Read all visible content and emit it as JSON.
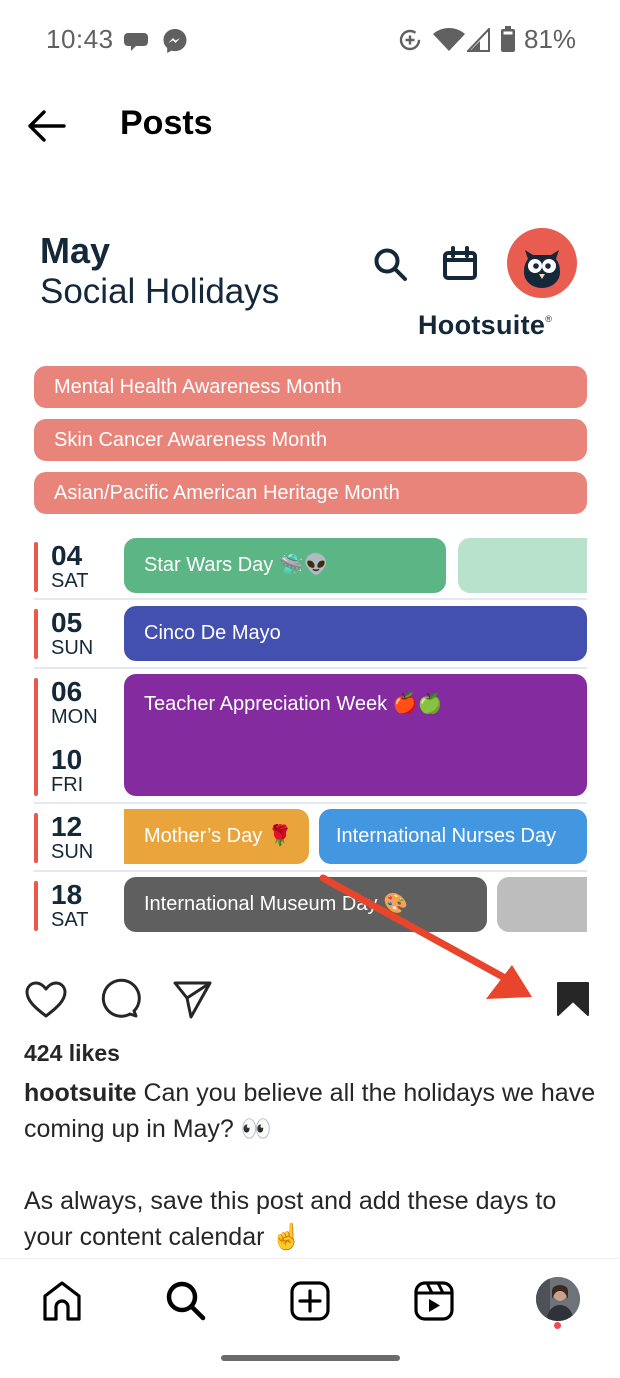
{
  "status_bar": {
    "time": "10:43",
    "notification_icons": [
      "messages-icon",
      "messenger-icon"
    ],
    "system_icons": [
      "data-saver-icon",
      "wifi-icon",
      "signal-icon",
      "battery-icon"
    ],
    "battery_percent": "81%"
  },
  "header": {
    "back_icon": "arrow-left-icon",
    "title": "Posts"
  },
  "post_image": {
    "title_bold": "May",
    "title_sub": "Social Holidays",
    "brand": "Hootsuite",
    "brand_mark": "®",
    "colors": {
      "brand_red": "#e85d4f",
      "navy": "#14283a",
      "month_pill": "#e8847a"
    },
    "month_observances": [
      {
        "label": "Mental Health Awareness Month"
      },
      {
        "label": "Skin Cancer Awareness Month"
      },
      {
        "label": "Asian/Pacific American Heritage Month"
      }
    ],
    "days": [
      {
        "num": "04",
        "dow": "SAT",
        "events": [
          {
            "label": "Star Wars Day 🛸👽",
            "color": "#5cb584"
          },
          {
            "label": "",
            "color": "#b8e2cb"
          }
        ]
      },
      {
        "num": "05",
        "dow": "SUN",
        "events": [
          {
            "label": "Cinco De Mayo",
            "color": "#4450b0"
          }
        ]
      },
      {
        "num": "06",
        "dow": "MON",
        "num2": "10",
        "dow2": "FRI",
        "events": [
          {
            "label": "Teacher Appreciation Week 🍎🍏",
            "color": "#842ba0"
          }
        ]
      },
      {
        "num": "12",
        "dow": "SUN",
        "events": [
          {
            "label": "Mother’s Day 🌹",
            "color": "#eaa43c"
          },
          {
            "label": "International Nurses Day",
            "color": "#4396e0"
          }
        ]
      },
      {
        "num": "18",
        "dow": "SAT",
        "events": [
          {
            "label": "International Museum Day 🎨",
            "color": "#5f5f5f"
          },
          {
            "label": "",
            "color": "#bdbdbd"
          }
        ]
      }
    ]
  },
  "annotation": {
    "arrow_color": "#e8452c",
    "points_to": "save-button"
  },
  "actions": {
    "like_icon": "heart-icon",
    "comment_icon": "comment-icon",
    "share_icon": "send-icon",
    "save_icon": "bookmark-filled-icon",
    "saved": true
  },
  "likes": "424 likes",
  "caption": {
    "username": "hootsuite",
    "line1": " Can you believe all the holidays we have coming up in May? 👀",
    "line2": "As always, save this post and add these days to your content calendar ☝️"
  },
  "bottom_nav": {
    "items": [
      "home-icon",
      "search-icon",
      "create-icon",
      "reels-icon",
      "profile-avatar"
    ],
    "active": "search",
    "profile_has_notification": true
  }
}
